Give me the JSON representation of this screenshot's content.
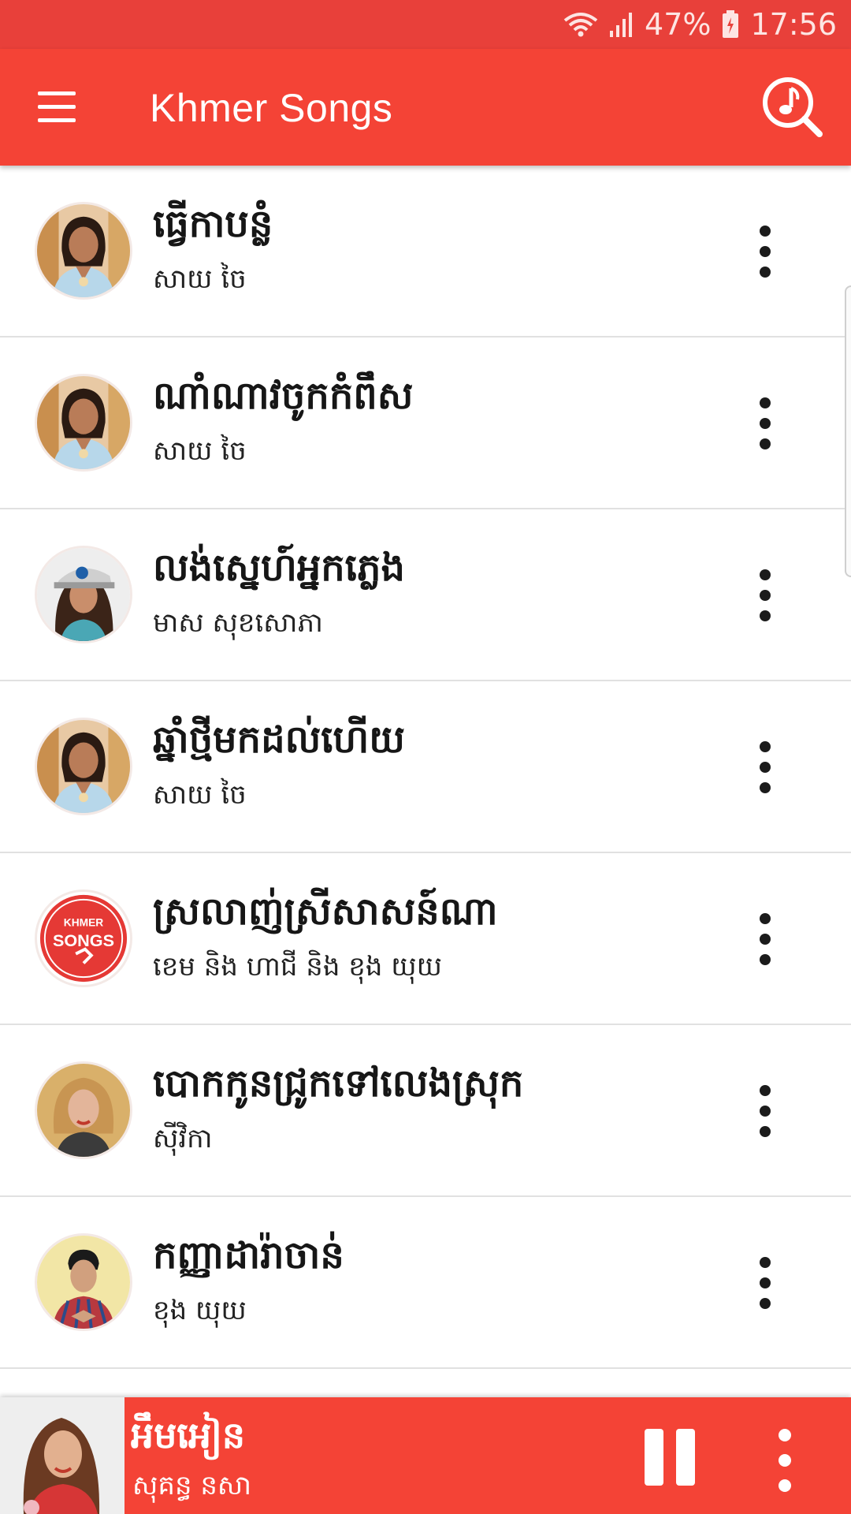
{
  "status_bar": {
    "battery": "47%",
    "time": "17:56"
  },
  "app_bar": {
    "title": "Khmer Songs",
    "menu_icon": "hamburger-menu-icon",
    "search_icon": "music-search-icon"
  },
  "songs": [
    {
      "title": "ធ្វើកាបន្លំ",
      "artist": "សាយ ចៃ",
      "avatar": "singer-photo"
    },
    {
      "title": "ណាំណាវចូកកំពឹស",
      "artist": "សាយ ចៃ",
      "avatar": "singer-photo"
    },
    {
      "title": "លង់ស្នេហ៍អ្នកភ្លេង",
      "artist": "មាស សុខសោភា",
      "avatar": "singer-photo-cap"
    },
    {
      "title": "ឆ្នាំថ្មីមកដល់ហើយ",
      "artist": "សាយ ចៃ",
      "avatar": "singer-photo"
    },
    {
      "title": "ស្រលាញ់ស្រីសាសន៍ណា",
      "artist": "ខេម និង ហាជី និង ខុង យុយ",
      "avatar": "khmer-songs-logo",
      "logo_text_top": "KHMER",
      "logo_text_bottom": "SONGS"
    },
    {
      "title": "បោកកូនជ្រូកទៅលេងស្រុក",
      "artist": "ស៊ីវិកា",
      "avatar": "singer-photo-blonde"
    },
    {
      "title": "កញ្ញាដារ៉ាចាន់",
      "artist": "ខុង យុយ",
      "avatar": "singer-photo-male"
    }
  ],
  "player": {
    "title": "អឹមអៀន",
    "artist": "សុគន្ធ នសា",
    "pause_icon": "pause-icon",
    "more_icon": "more-vert-icon"
  },
  "colors": {
    "status_bar": "#e8403a",
    "primary": "#f44336"
  }
}
